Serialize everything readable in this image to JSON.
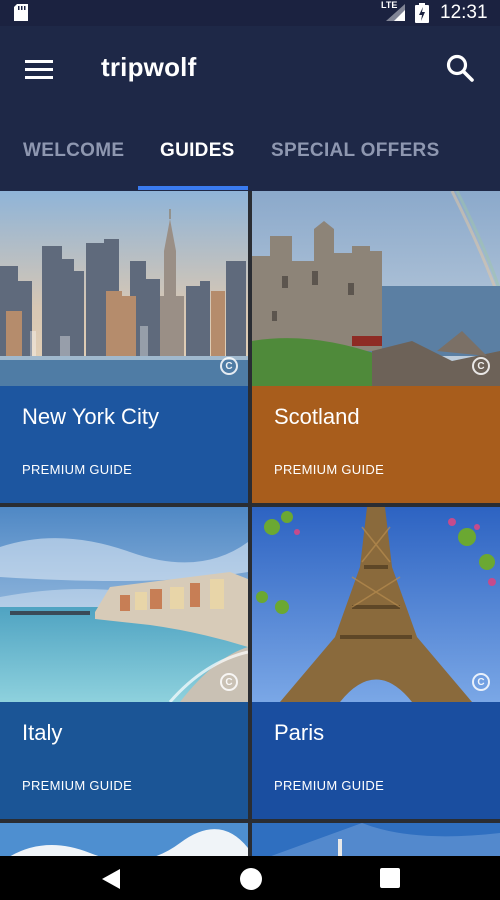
{
  "status_bar": {
    "network": "LTE",
    "time": "12:31",
    "icons": [
      "sd-card-icon",
      "signal-icon",
      "battery-charging-icon"
    ]
  },
  "app_bar": {
    "title": "tripwolf",
    "icons": [
      "menu-icon",
      "search-icon"
    ]
  },
  "tabs": [
    {
      "label": "WELCOME",
      "active": false
    },
    {
      "label": "GUIDES",
      "active": true
    },
    {
      "label": "SPECIAL OFFERS",
      "active": false
    }
  ],
  "guides": [
    {
      "name": "New York City",
      "label": "PREMIUM GUIDE",
      "color": "#1d56a0"
    },
    {
      "name": "Scotland",
      "label": "PREMIUM GUIDE",
      "color": "#a85d1c"
    },
    {
      "name": "Italy",
      "label": "PREMIUM GUIDE",
      "color": "#1b5596"
    },
    {
      "name": "Paris",
      "label": "PREMIUM GUIDE",
      "color": "#1a4ea0"
    }
  ],
  "copyright_symbol": "C",
  "colors": {
    "header_bg": "#1e2847",
    "tab_indicator": "#3a7bf0",
    "tab_inactive": "#8e97b0"
  }
}
